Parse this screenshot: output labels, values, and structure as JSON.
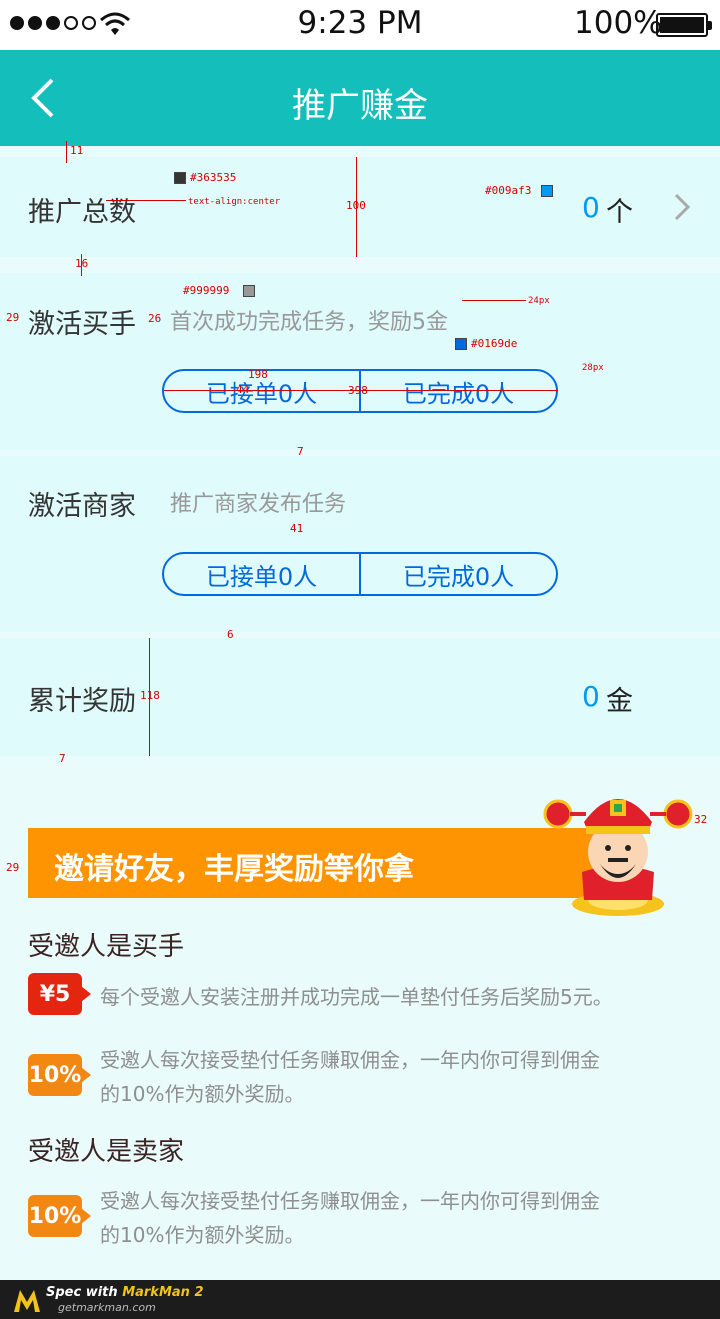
{
  "status_bar": {
    "time": "9:23 PM",
    "battery": "100%"
  },
  "nav": {
    "title": "推广赚金"
  },
  "total": {
    "label": "推广总数",
    "value": "0",
    "unit": "个"
  },
  "buyer": {
    "label": "激活买手",
    "hint": "首次成功完成任务，奖励5金",
    "accepted": "已接单0人",
    "completed": "已完成0人"
  },
  "merchant": {
    "label": "激活商家",
    "hint": "推广商家发布任务",
    "accepted": "已接单0人",
    "completed": "已完成0人"
  },
  "reward": {
    "label": "累计奖励",
    "value": "0",
    "unit": "金"
  },
  "promo": {
    "banner": "邀请好友，丰厚奖励等你拿",
    "buyer_title": "受邀人是买手",
    "buyer_items": [
      {
        "badge": "¥5",
        "text": "每个受邀人安装注册并成功完成一单垫付任务后奖励5元。"
      },
      {
        "badge": "10%",
        "line1": "受邀人每次接受垫付任务赚取佣金，一年内你可得到佣金",
        "line2": "的10%作为额外奖励。"
      }
    ],
    "seller_title": "受邀人是卖家",
    "seller_items": [
      {
        "badge": "10%",
        "line1": "受邀人每次接受垫付任务赚取佣金，一年内你可得到佣金",
        "line2": "的10%作为额外奖励。"
      }
    ]
  },
  "annotations": {
    "a11": "11",
    "c363535": "#363535",
    "center": "text-align:center",
    "c009af3": "#009af3",
    "a100": "100",
    "a16": "16",
    "c999999": "#999999",
    "a29a": "29",
    "a26": "26",
    "px24": "24px",
    "c0169de": "#0169de",
    "a198": "198",
    "a44": "44",
    "a398": "398",
    "px28": "28px",
    "a7a": "7",
    "a41": "41",
    "a6": "6",
    "a118": "118",
    "a7b": "7",
    "a32": "32",
    "a29b": "29"
  },
  "footer": {
    "line1_a": "Spec with ",
    "line1_b": "MarkMan 2",
    "line2": "getmarkman.com"
  },
  "colors": {
    "teal": "#13bebb",
    "accent": "#009af3",
    "pill": "#0169de",
    "banner": "#ff9402"
  }
}
